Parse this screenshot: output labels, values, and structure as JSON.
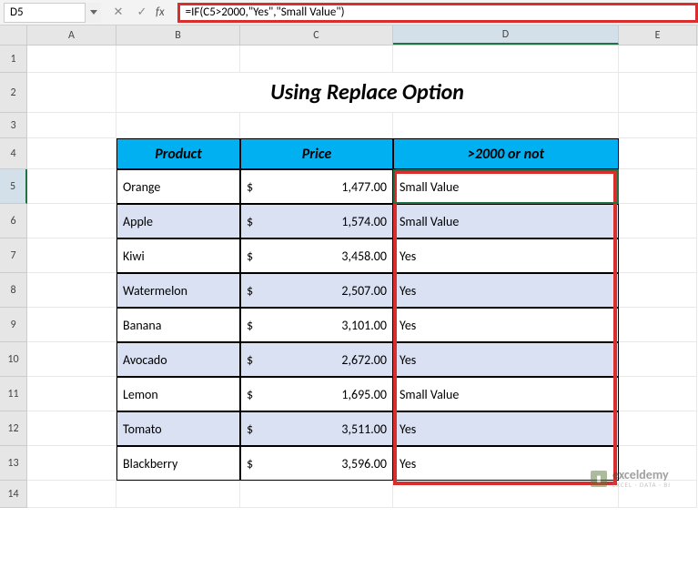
{
  "name_box": "D5",
  "formula": "=IF(C5>2000,\"Yes\",\"Small Value\")",
  "columns": [
    "A",
    "B",
    "C",
    "D",
    "E"
  ],
  "title": "Using Replace Option",
  "headers": {
    "product": "Product",
    "price": "Price",
    "check": ">2000 or not"
  },
  "chart_data": {
    "type": "table",
    "columns": [
      "Product",
      "Price",
      ">2000 or not"
    ],
    "rows": [
      {
        "product": "Orange",
        "price": 1477.0,
        "check": "Small Value"
      },
      {
        "product": "Apple",
        "price": 1574.0,
        "check": "Small Value"
      },
      {
        "product": "Kiwi",
        "price": 3458.0,
        "check": "Yes"
      },
      {
        "product": "Watermelon",
        "price": 2507.0,
        "check": "Yes"
      },
      {
        "product": "Banana",
        "price": 3101.0,
        "check": "Yes"
      },
      {
        "product": "Avocado",
        "price": 2672.0,
        "check": "Yes"
      },
      {
        "product": "Lemon",
        "price": 1695.0,
        "check": "Small Value"
      },
      {
        "product": "Tomato",
        "price": 3511.0,
        "check": "Yes"
      },
      {
        "product": "Blackberry",
        "price": 3596.0,
        "check": "Yes"
      }
    ],
    "price_display": [
      "1,477.00",
      "1,574.00",
      "3,458.00",
      "2,507.00",
      "3,101.00",
      "2,672.00",
      "1,695.00",
      "3,511.00",
      "3,596.00"
    ]
  },
  "currency_symbol": "$",
  "watermark": {
    "brand": "exceldemy",
    "tag": "EXCEL · DATA · BI"
  },
  "fb_icons": {
    "cancel": "✕",
    "enter": "✓",
    "fx": "fx"
  },
  "row_numbers": [
    "1",
    "2",
    "3",
    "4",
    "5",
    "6",
    "7",
    "8",
    "9",
    "10",
    "11",
    "12",
    "13",
    "14"
  ]
}
